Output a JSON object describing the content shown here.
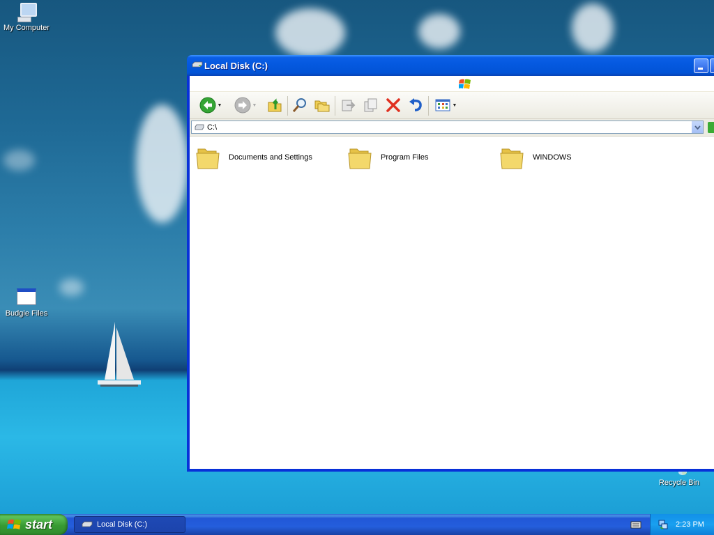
{
  "desktop": {
    "icons": {
      "my_computer": "My Computer",
      "budgie_files": "Budgie Files",
      "recycle_bin": "Recycle Bin"
    }
  },
  "window": {
    "title": "Local Disk (C:)",
    "address": "C:\\",
    "toolbar_icons": [
      "back-icon",
      "forward-icon",
      "up-folder-icon",
      "search-icon",
      "folders-icon",
      "move-to-icon",
      "copy-to-icon",
      "delete-icon",
      "undo-icon",
      "views-icon"
    ],
    "items": [
      {
        "name": "Documents and Settings",
        "icon": "folder-icon"
      },
      {
        "name": "Program Files",
        "icon": "folder-icon"
      },
      {
        "name": "WINDOWS",
        "icon": "folder-icon"
      }
    ]
  },
  "taskbar": {
    "start_label": "start",
    "task_button": "Local Disk (C:)",
    "clock": "2:23 PM"
  },
  "colors": {
    "title_blue": "#0458de",
    "taskbar_blue": "#245edc",
    "start_green": "#389b33",
    "folder_yellow": "#f3d86b"
  }
}
